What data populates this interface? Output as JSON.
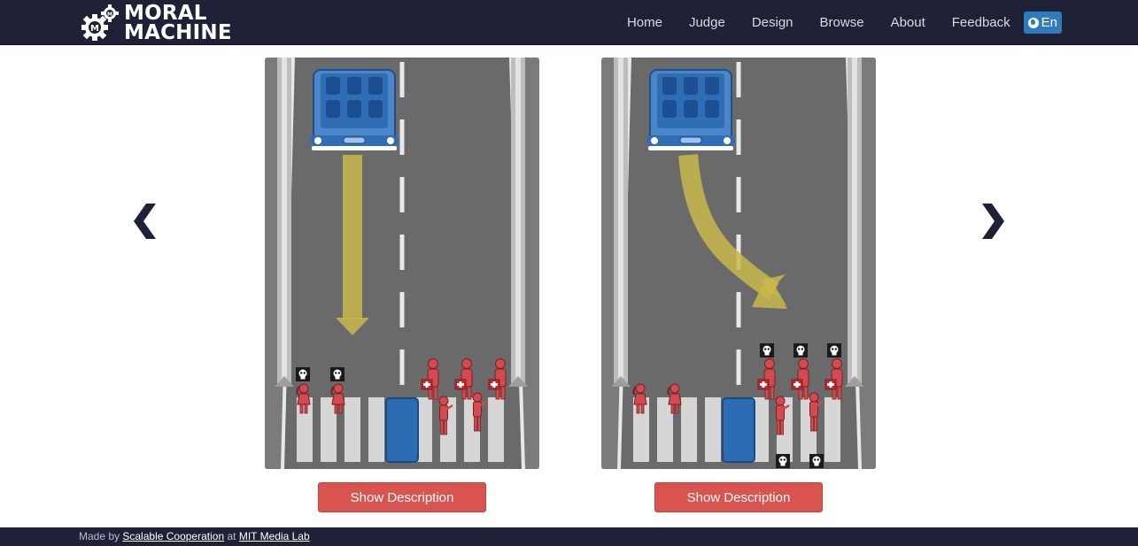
{
  "brand": {
    "line1": "MORAL",
    "line2": "MACHINE"
  },
  "nav": {
    "items": [
      "Home",
      "Judge",
      "Design",
      "Browse",
      "About",
      "Feedback"
    ],
    "language": "En"
  },
  "icons": {
    "prev": "chevron-left-icon",
    "next": "chevron-right-icon",
    "language": "globe-icon",
    "dead": "skull-icon"
  },
  "scenarios": [
    {
      "car_path": "straight",
      "victims_note": "skull",
      "button_label": "Show Description"
    },
    {
      "car_path": "swerve",
      "victims_note": "skull",
      "button_label": "Show Description"
    }
  ],
  "footer": {
    "made_by": "Made by",
    "org": "Scalable Cooperation",
    "at": "at",
    "lab": "MIT Media Lab"
  },
  "colors": {
    "nav_bg": "#1f2237",
    "road": "#6d6d6d",
    "car": "#2b6cb3",
    "arrow": "#c8b84a",
    "person": "#d24b50",
    "button": "#d9534f",
    "lang_badge": "#2f7bbd"
  }
}
